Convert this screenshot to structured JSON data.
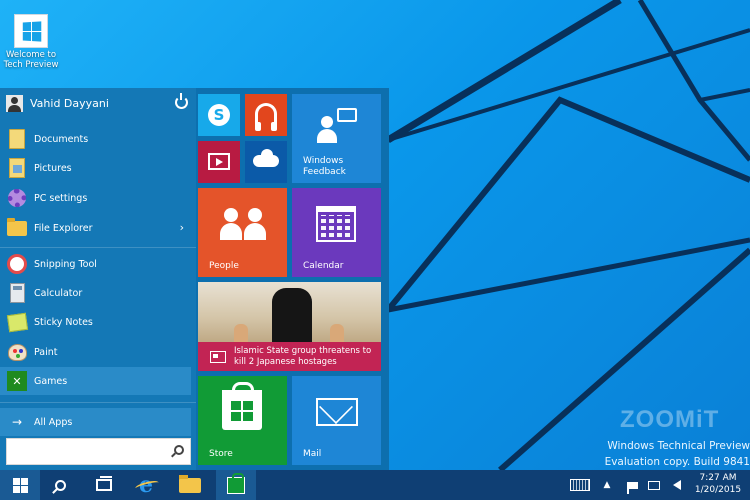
{
  "desktop": {
    "icon_label": "Welcome to Tech Preview",
    "icon": "windows-logo-icon",
    "watermark_line1": "Windows Technical Preview",
    "watermark_line2": "Evaluation copy. Build 9841",
    "site_logo": "ZOOMiT"
  },
  "start_menu": {
    "user_name": "Vahid Dayyani",
    "power_icon": "power-icon",
    "places": [
      {
        "label": "Documents",
        "icon": "documents-icon"
      },
      {
        "label": "Pictures",
        "icon": "pictures-icon"
      },
      {
        "label": "PC settings",
        "icon": "gear-icon"
      },
      {
        "label": "File Explorer",
        "icon": "folder-icon"
      }
    ],
    "apps": [
      {
        "label": "Snipping Tool",
        "icon": "snipping-tool-icon"
      },
      {
        "label": "Calculator",
        "icon": "calculator-icon"
      },
      {
        "label": "Sticky Notes",
        "icon": "sticky-notes-icon"
      },
      {
        "label": "Paint",
        "icon": "paint-icon"
      },
      {
        "label": "Games",
        "icon": "games-icon"
      }
    ],
    "all_apps_label": "All Apps",
    "search_placeholder": ""
  },
  "tiles": {
    "windows_feedback": "Windows Feedback",
    "people": "People",
    "calendar": "Calendar",
    "news_headline": "Islamic State group threatens to kill 2 Japanese hostages",
    "store": "Store",
    "mail": "Mail"
  },
  "taskbar": {
    "time": "7:27 AM",
    "date": "1/20/2015"
  },
  "colors": {
    "start_left": "#1478b6",
    "start_right": "#0d6fae",
    "taskbar": "#0f3f74",
    "accent_store": "#119b36",
    "news_bar": "#c22454"
  }
}
